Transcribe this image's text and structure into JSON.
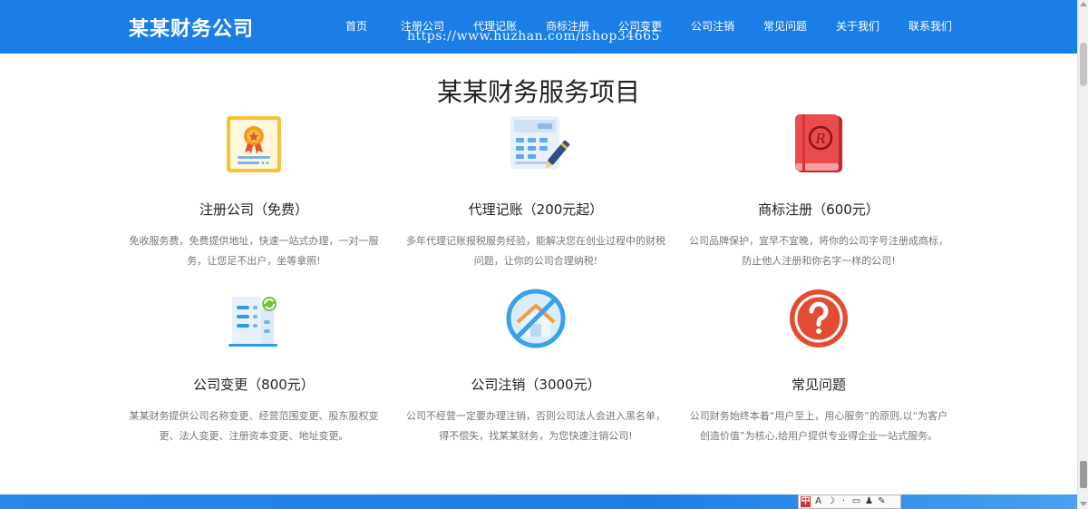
{
  "header": {
    "logo": "某某财务公司",
    "nav": [
      "首页",
      "注册公司",
      "代理记账",
      "商标注册",
      "公司变更",
      "公司注销",
      "常见问题",
      "关于我们",
      "联系我们"
    ]
  },
  "watermark": "https://www.huzhan.com/ishop34665",
  "section": {
    "title": "某某财务服务项目",
    "services": [
      {
        "title": "注册公司（免费）",
        "desc": "免收服务费，免费提供地址，快速一站式办理，一对一服务，让您足不出户，坐等拿照!",
        "icon": "certificate-icon"
      },
      {
        "title": "代理记账（200元起）",
        "desc": "多年代理记账报税服务经验，能解决您在创业过程中的财税问题，让你的公司合理纳税!",
        "icon": "calculator-icon"
      },
      {
        "title": "商标注册（600元）",
        "desc": "公司品牌保护，宜早不宜晚，将你的公司字号注册成商标，防止他人注册和你名字一样的公司!",
        "icon": "trademark-book-icon"
      },
      {
        "title": "公司变更（800元）",
        "desc": "某某财务提供公司名称变更、经营范围变更、股东股权变更、法人变更、注册资本变更、地址变更。",
        "icon": "building-change-icon"
      },
      {
        "title": "公司注销（3000元）",
        "desc": "公司不经营一定要办理注销，否则公司法人会进入黑名单，得不偿失，找某某财务，为您快速注销公司!",
        "icon": "house-cancel-icon"
      },
      {
        "title": "常见问题",
        "desc": "公司财务始终本着“用户至上，用心服务”的原则,以“为客户创造价值”为核心,给用户提供专业得企业一站式服务。",
        "icon": "question-icon"
      }
    ]
  },
  "ime": [
    "中",
    "A",
    "☽",
    "·",
    "▭",
    "♟",
    "✎"
  ],
  "colors": {
    "brand": "#1b7ee6",
    "title": "#222222",
    "desc": "#777777"
  }
}
